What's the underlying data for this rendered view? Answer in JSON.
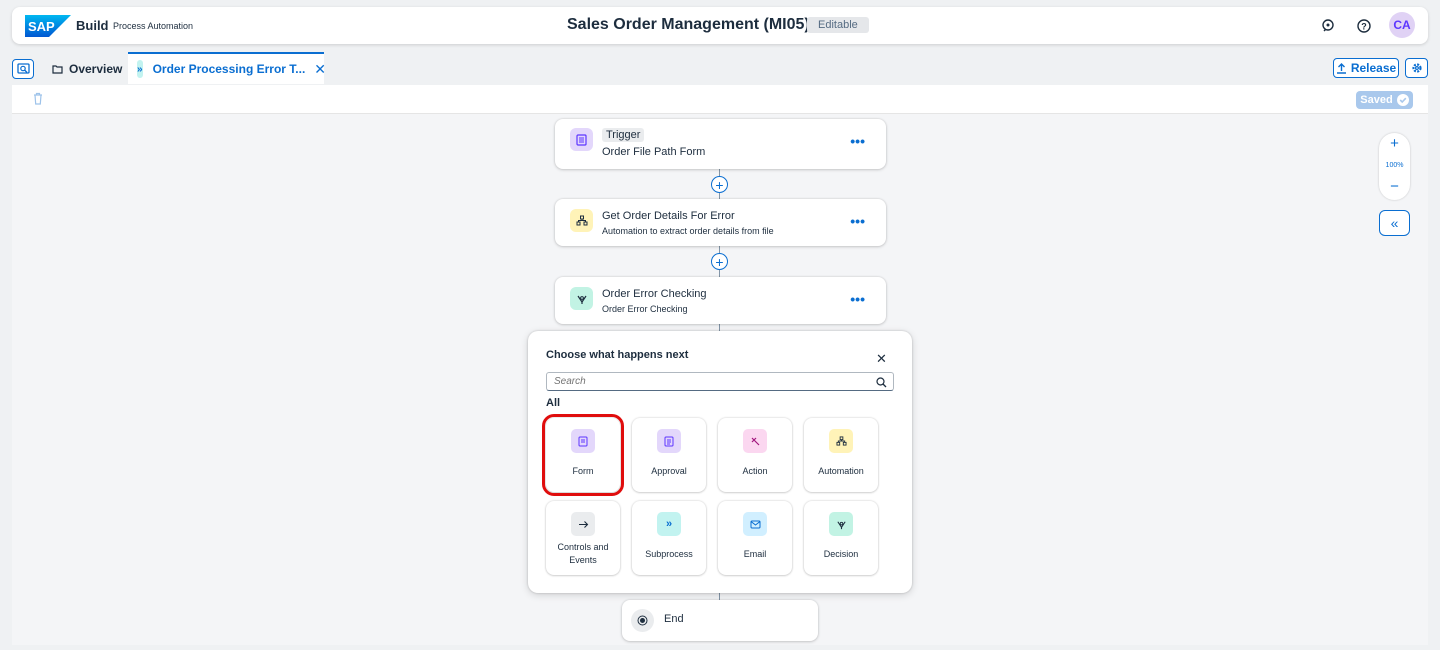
{
  "shell": {
    "logo_text": "SAP",
    "app_name": "Build",
    "app_sub": "Process Automation",
    "title": "Sales Order Management (MI05)",
    "badge": "Editable",
    "avatar_initials": "CA"
  },
  "tabs": {
    "overview": "Overview",
    "active": "Order Processing Error T...",
    "release": "Release"
  },
  "toolbar": {
    "saved": "Saved"
  },
  "flow": {
    "trigger": {
      "tag": "Trigger",
      "subtitle": "Order File Path Form"
    },
    "step2": {
      "title": "Get Order Details For Error",
      "subtitle": "Automation to extract order details from file"
    },
    "step3": {
      "title": "Order Error Checking",
      "subtitle": "Order Error Checking"
    },
    "end": "End"
  },
  "zoom": {
    "plus": "+",
    "level": "100%",
    "minus": "−"
  },
  "popover": {
    "title": "Choose what happens next",
    "search_placeholder": "Search",
    "section": "All",
    "tiles": [
      {
        "label": "Form"
      },
      {
        "label": "Approval"
      },
      {
        "label": "Action"
      },
      {
        "label": "Automation"
      },
      {
        "label": "Controls and Events"
      },
      {
        "label": "Subprocess"
      },
      {
        "label": "Email"
      },
      {
        "label": "Decision"
      }
    ]
  },
  "colors": {
    "accent": "#0a6ed1",
    "highlight": "#e00d0d"
  }
}
